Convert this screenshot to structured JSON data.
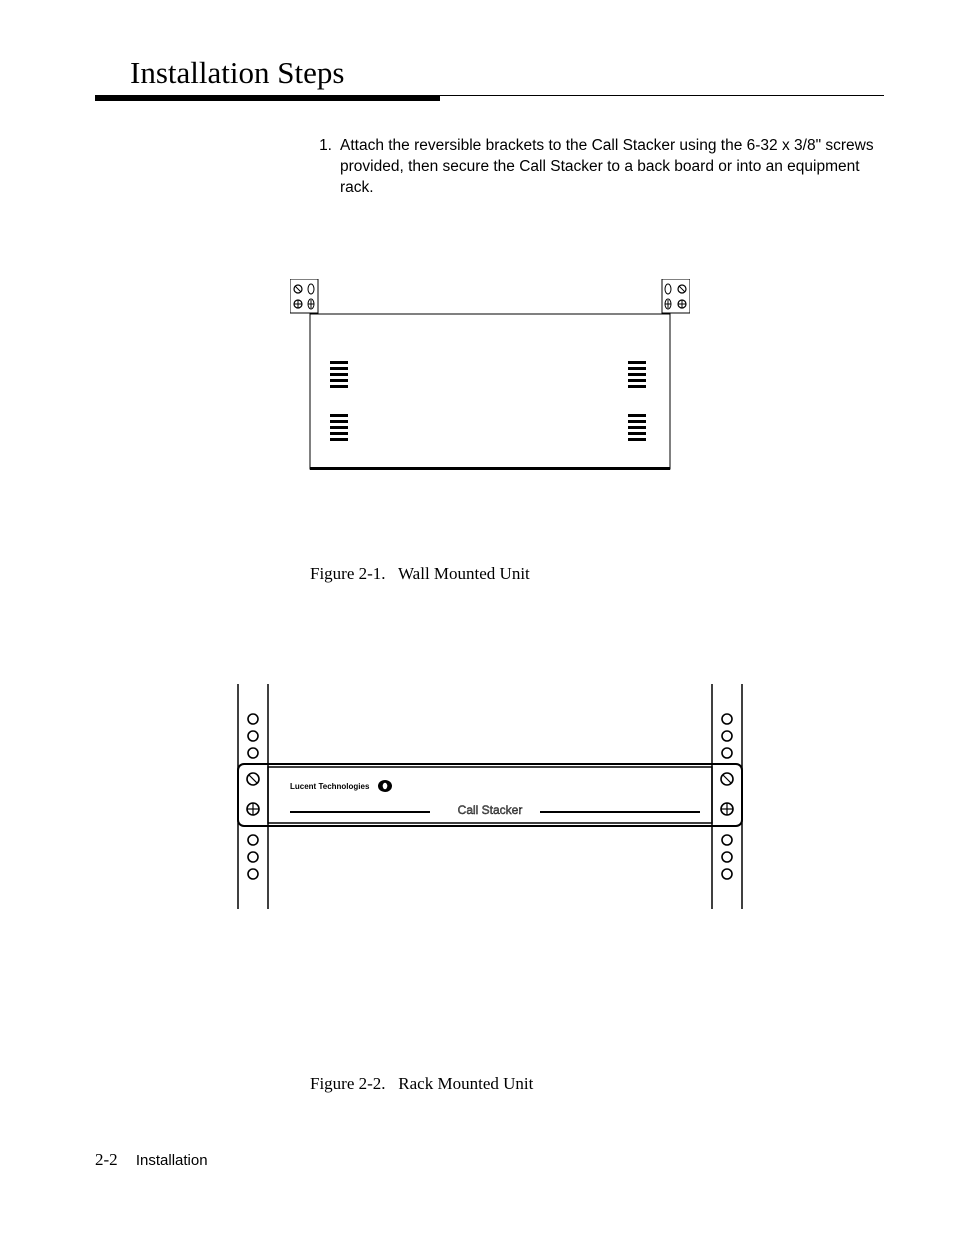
{
  "heading": "Installation Steps",
  "step": {
    "number": "1.",
    "text": "Attach the reversible brackets to the Call Stacker using the 6-32 x 3/8\" screws provided, then secure the Call Stacker to a back board or into an equipment rack."
  },
  "figure1": {
    "caption_prefix": "Figure 2-1.",
    "caption_text": "Wall Mounted Unit"
  },
  "figure2": {
    "caption_prefix": "Figure 2-2.",
    "caption_text": "Rack Mounted Unit",
    "brand": "Lucent Technologies",
    "product": "Call Stacker"
  },
  "footer": {
    "page": "2-2",
    "section": "Installation"
  }
}
